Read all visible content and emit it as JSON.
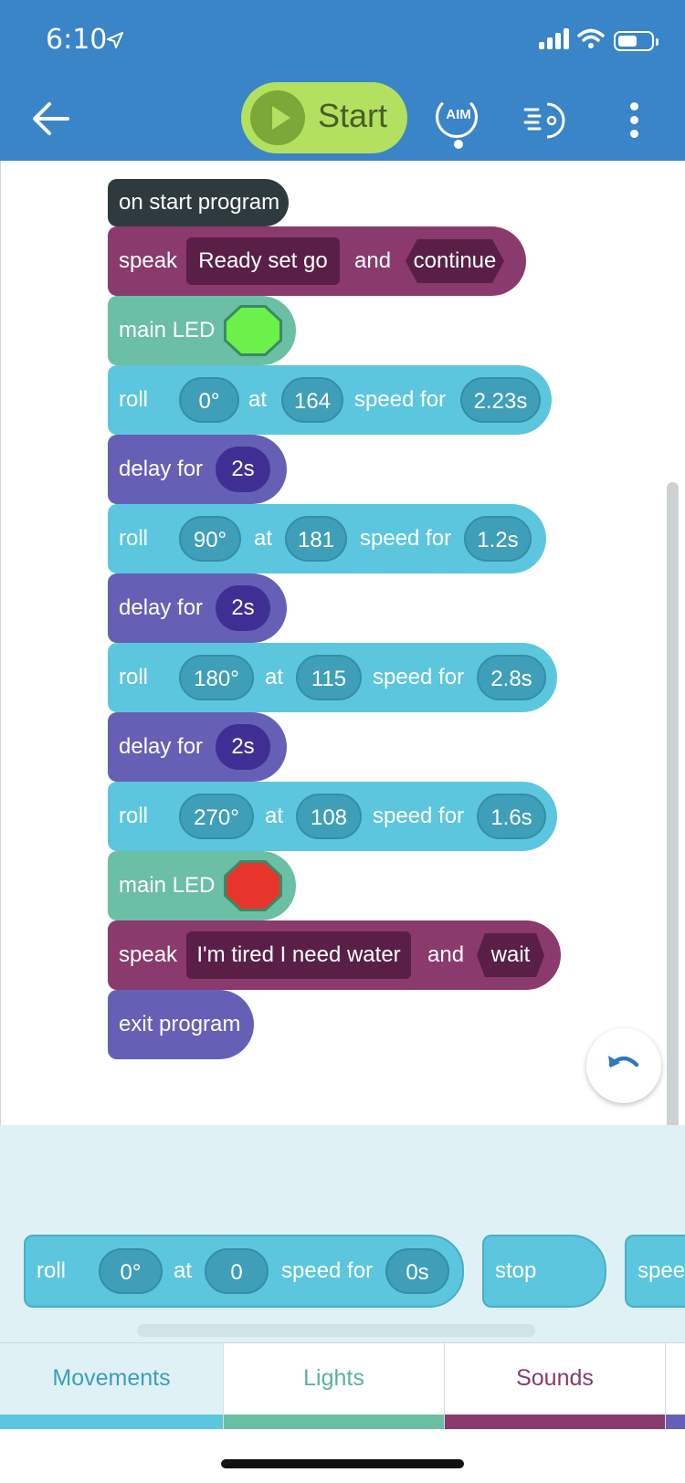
{
  "status_bar": {
    "time": "6:10"
  },
  "toolbar": {
    "start_label": "Start",
    "aim_label": "AIM",
    "icons": [
      "back-arrow-icon",
      "play-icon",
      "aim-icon",
      "speedometer-icon",
      "more-vertical-icon"
    ]
  },
  "program": {
    "start": "on start program",
    "speak1": {
      "verb": "speak",
      "text": "Ready set go",
      "and": "and",
      "mode": "continue"
    },
    "led1": {
      "label": "main LED",
      "color": "#6cf14a"
    },
    "roll1": {
      "verb": "roll",
      "heading": "0°",
      "at": "at",
      "speed": "164",
      "speed_for": "speed for",
      "duration": "2.23s"
    },
    "delay1": {
      "label": "delay for",
      "value": "2s"
    },
    "roll2": {
      "verb": "roll",
      "heading": "90°",
      "at": "at",
      "speed": "181",
      "speed_for": "speed for",
      "duration": "1.2s"
    },
    "delay2": {
      "label": "delay for",
      "value": "2s"
    },
    "roll3": {
      "verb": "roll",
      "heading": "180°",
      "at": "at",
      "speed": "115",
      "speed_for": "speed for",
      "duration": "2.8s"
    },
    "delay3": {
      "label": "delay for",
      "value": "2s"
    },
    "roll4": {
      "verb": "roll",
      "heading": "270°",
      "at": "at",
      "speed": "108",
      "speed_for": "speed for",
      "duration": "1.6s"
    },
    "led2": {
      "label": "main LED",
      "color": "#e8352b"
    },
    "speak2": {
      "verb": "speak",
      "text": "I'm tired I need water",
      "and": "and",
      "mode": "wait"
    },
    "exit": "exit program"
  },
  "palette": {
    "roll": {
      "verb": "roll",
      "heading": "0°",
      "at": "at",
      "speed": "0",
      "speed_for": "speed for",
      "duration": "0s"
    },
    "stop": "stop",
    "partial": "spee"
  },
  "tabs": [
    {
      "label": "Movements",
      "color": "#5cc6df",
      "text_color": "#3aa0b8"
    },
    {
      "label": "Lights",
      "color": "#6bbfa5",
      "text_color": "#58b39a"
    },
    {
      "label": "Sounds",
      "color": "#8a3a6c",
      "text_color": "#8a3a6c"
    }
  ]
}
